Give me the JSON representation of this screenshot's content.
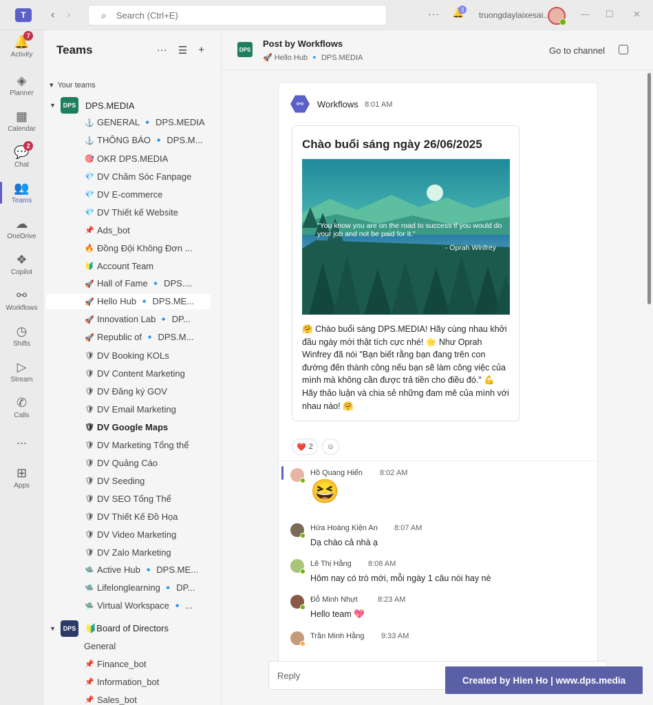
{
  "titlebar": {
    "search_placeholder": "Search (Ctrl+E)",
    "user_name": "truongdaylaixesai...",
    "notif_count": "3"
  },
  "rail": {
    "items": [
      {
        "label": "Activity",
        "icon": "bell-icon",
        "badge": "7"
      },
      {
        "label": "Planner",
        "icon": "planner-icon",
        "badge": ""
      },
      {
        "label": "Calendar",
        "icon": "calendar-icon",
        "badge": ""
      },
      {
        "label": "Chat",
        "icon": "chat-icon",
        "badge": "2"
      },
      {
        "label": "Teams",
        "icon": "teams-icon",
        "badge": ""
      },
      {
        "label": "OneDrive",
        "icon": "cloud-icon",
        "badge": ""
      },
      {
        "label": "Copilot",
        "icon": "copilot-icon",
        "badge": ""
      },
      {
        "label": "Workflows",
        "icon": "workflows-icon",
        "badge": ""
      },
      {
        "label": "Shifts",
        "icon": "clock-icon",
        "badge": ""
      },
      {
        "label": "Stream",
        "icon": "play-icon",
        "badge": ""
      },
      {
        "label": "Calls",
        "icon": "phone-icon",
        "badge": ""
      },
      {
        "label": "...",
        "icon": "more-icon",
        "badge": ""
      },
      {
        "label": "Apps",
        "icon": "plus-box-icon",
        "badge": ""
      }
    ]
  },
  "pane": {
    "title": "Teams",
    "section_label": "Your teams",
    "team1": {
      "name": "DPS.MEDIA"
    },
    "channels": [
      {
        "emoji": "⚓",
        "label": "GENERAL 🔹 DPS.MEDIA"
      },
      {
        "emoji": "⚓",
        "label": "THÔNG BÁO 🔹 DPS.M..."
      },
      {
        "emoji": "🎯",
        "label": "OKR DPS.MEDIA"
      },
      {
        "emoji": "💎",
        "label": "DV Chăm Sóc Fanpage"
      },
      {
        "emoji": "💎",
        "label": "DV E-commerce"
      },
      {
        "emoji": "💎",
        "label": "DV Thiết kế Website"
      },
      {
        "emoji": "📌",
        "label": "Ads_bot"
      },
      {
        "emoji": "🔥",
        "label": "Đồng Đội Không Đơn ..."
      },
      {
        "emoji": "🔰",
        "label": "Account Team"
      },
      {
        "emoji": "🚀",
        "label": "Hall of Fame 🔹 DPS...."
      },
      {
        "emoji": "🚀",
        "label": "Hello Hub 🔹 DPS.ME..."
      },
      {
        "emoji": "🚀",
        "label": "Innovation Lab 🔹 DP..."
      },
      {
        "emoji": "🚀",
        "label": "Republic of 🔹 DPS.M..."
      },
      {
        "emoji": "🛡",
        "label": "DV Booking KOLs"
      },
      {
        "emoji": "🛡",
        "label": "DV Content Marketing"
      },
      {
        "emoji": "🛡",
        "label": "DV Đăng ký GOV"
      },
      {
        "emoji": "🛡",
        "label": "DV Email Marketing"
      },
      {
        "emoji": "🛡",
        "label": "DV Google Maps"
      },
      {
        "emoji": "🛡",
        "label": "DV Marketing Tổng thể"
      },
      {
        "emoji": "🛡",
        "label": "DV Quảng Cáo"
      },
      {
        "emoji": "🛡",
        "label": "DV Seeding"
      },
      {
        "emoji": "🛡",
        "label": "DV SEO Tổng Thể"
      },
      {
        "emoji": "🛡",
        "label": "DV Thiết Kế Đồ Họa"
      },
      {
        "emoji": "🛡",
        "label": "DV Video Marketing"
      },
      {
        "emoji": "🛡",
        "label": "DV Zalo Marketing"
      },
      {
        "emoji": "🛸",
        "label": "Active Hub 🔹 DPS.ME..."
      },
      {
        "emoji": "🛸",
        "label": "Lifelonglearning 🔹 DP..."
      },
      {
        "emoji": "🛸",
        "label": "Virtual Workspace 🔹 ..."
      }
    ],
    "team2": {
      "name": "🔰Board of Directors"
    },
    "channels2": [
      {
        "emoji": "",
        "label": "General"
      },
      {
        "emoji": "📌",
        "label": "Finance_bot"
      },
      {
        "emoji": "📌",
        "label": "Information_bot"
      },
      {
        "emoji": "📌",
        "label": "Sales_bot"
      }
    ]
  },
  "main": {
    "title": "Post by Workflows",
    "crumb": "🚀 Hello Hub 🔹 DPS.MEDIA",
    "go_to_channel": "Go to channel",
    "post": {
      "author": "Workflows",
      "time": "8:01 AM",
      "card_title": "Chào buổi sáng ngày 26/06/2025",
      "quote": "\"You know you are on the road to success if you would do your job and not be paid for it.\"",
      "quote_by": "- Oprah Winfrey",
      "body": "🤗 Chào buổi sáng DPS.MEDIA! Hãy cùng nhau khởi đầu ngày mới thật tích cực nhé! 🌟 Như Oprah Winfrey đã nói \"Bạn biết rằng bạn đang trên con đường đến thành công nếu bạn sẽ làm công việc của mình mà không cần được trả tiền cho điều đó.\" 💪 Hãy thảo luận và chia sẻ những đam mê của mình với nhau nào! 🤗",
      "reaction_emoji": "❤️",
      "reaction_count": "2"
    },
    "replies": [
      {
        "name": "Hồ Quang Hiển",
        "time": "8:02 AM",
        "msg": "😆"
      },
      {
        "name": "Hứa Hoàng Kiện An",
        "time": "8:07 AM",
        "msg": "Dạ chào cả nhà ạ"
      },
      {
        "name": "Lê Thị Hằng",
        "time": "8:08 AM",
        "msg": "Hôm nay có trò mới, mỗi ngày 1 câu nói hay nè"
      },
      {
        "name": "Đỗ Minh Nhựt",
        "time": "8:23 AM",
        "msg": "Hello team 💖"
      },
      {
        "name": "Trần Minh Hằng",
        "time": "9:33 AM",
        "msg": ""
      }
    ],
    "reply_placeholder": "Reply",
    "watermark": "Created by Hien Ho | www.dps.media"
  }
}
